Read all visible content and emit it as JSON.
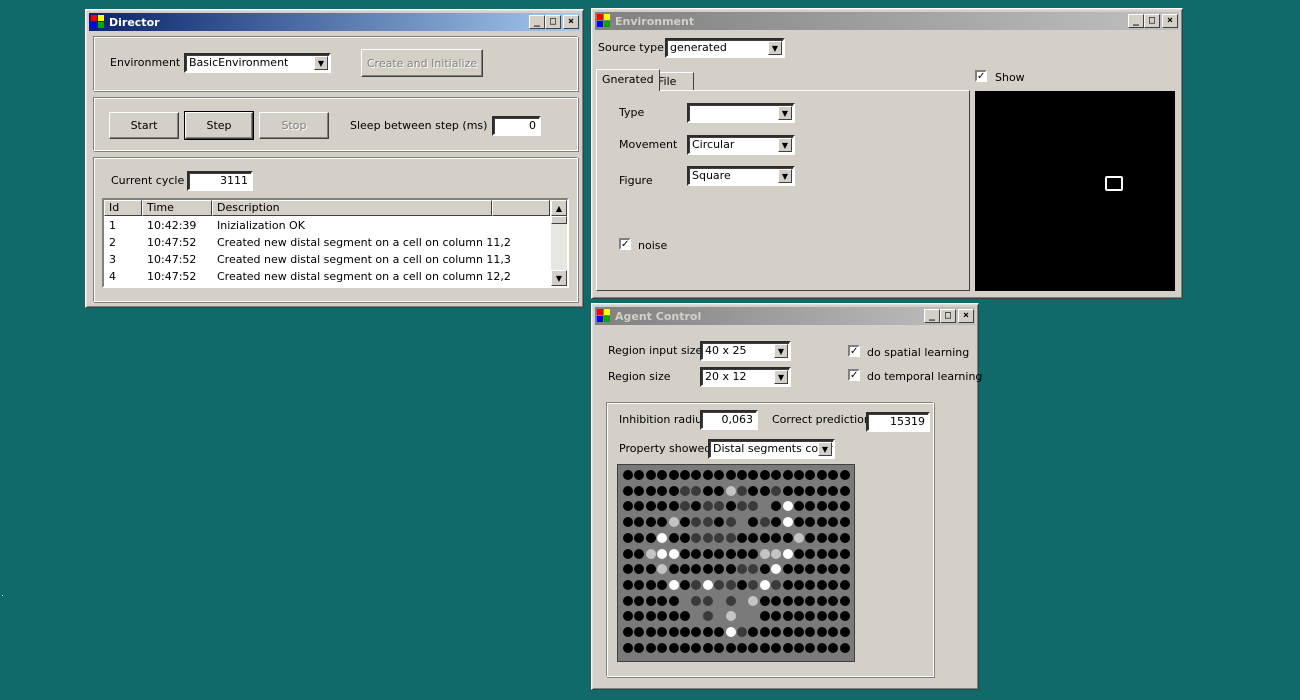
{
  "director": {
    "title": "Director",
    "env_label": "Environment",
    "env_value": "BasicEnvironment",
    "create_button": "Create and Initialize",
    "start_button": "Start",
    "step_button": "Step",
    "stop_button": "Stop",
    "sleep_label": "Sleep between step (ms)",
    "sleep_value": "0",
    "cycle_label": "Current cycle",
    "cycle_value": "3111",
    "log_columns": [
      "Id",
      "Time",
      "Description"
    ],
    "log_rows": [
      {
        "id": "1",
        "time": "10:42:39",
        "desc": "Inizialization OK"
      },
      {
        "id": "2",
        "time": "10:47:52",
        "desc": "Created new distal segment on a cell on column 11,2"
      },
      {
        "id": "3",
        "time": "10:47:52",
        "desc": "Created new distal segment on a cell on column 11,3"
      },
      {
        "id": "4",
        "time": "10:47:52",
        "desc": "Created new distal segment on a cell on column 12,2"
      }
    ]
  },
  "environment": {
    "title": "Environment",
    "source_label": "Source type",
    "source_value": "generated",
    "tab_generated": "Gnerated",
    "tab_file": "File",
    "type_label": "Type",
    "type_value": "",
    "movement_label": "Movement",
    "movement_value": "Circular",
    "figure_label": "Figure",
    "figure_value": "Square",
    "noise_label": "noise",
    "noise_checked": true,
    "show_label": "Show",
    "show_checked": true
  },
  "agent": {
    "title": "Agent Control",
    "input_size_label": "Region input size",
    "input_size_value": "40 x  25",
    "region_size_label": "Region size",
    "region_size_value": "20 x  12",
    "spatial_label": "do spatial learning",
    "spatial_checked": true,
    "temporal_label": "do temporal learning",
    "temporal_checked": true,
    "inhibition_label": "Inhibition radius",
    "inhibition_value": "0,063",
    "correct_label": "Correct prediction",
    "correct_value": "15319",
    "property_label": "Property showed",
    "property_value": "Distal segments count",
    "grid_colors": {
      "0": "#000000",
      "1": "#3a3a3a",
      "2": "#7a7a7a",
      "3": "#c4c4c4",
      "4": "#ffffff"
    },
    "grid": [
      "00000000000000000000",
      "00000110031001000000",
      "00000101101120400000",
      "00003011012010400000",
      "00040011110000030000",
      "00344000000033400000",
      "00030000001104000000",
      "00004014110141000000",
      "00000211212300000000",
      "00000021232200000000",
      "00000000041000000000",
      "00000000000000000000"
    ]
  },
  "titlebar_buttons": {
    "minimize": "_",
    "maximize": "□",
    "close": "×"
  }
}
